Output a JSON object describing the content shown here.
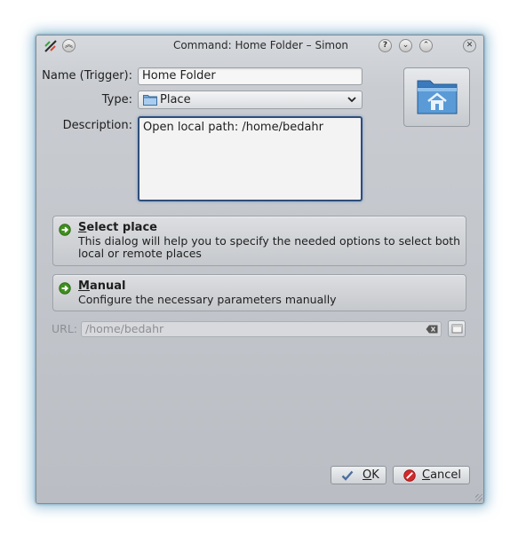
{
  "window": {
    "title": "Command: Home Folder – Simon",
    "titlebar_buttons": [
      "help",
      "minimize",
      "maximize",
      "close"
    ]
  },
  "form": {
    "name_label": "Name (Trigger):",
    "name_value": "Home Folder",
    "type_label": "Type:",
    "type_value": "Place",
    "type_icon": "folder-icon",
    "description_label": "Description:",
    "description_value": "Open local path: /home/bedahr",
    "command_icon": "home-folder-icon"
  },
  "options": [
    {
      "accel": "S",
      "title_rest": "elect place",
      "description": "This dialog will help you to specify the needed options to select both local or remote places"
    },
    {
      "accel": "M",
      "title_rest": "anual",
      "description": "Configure the necessary parameters manually"
    }
  ],
  "url": {
    "label": "URL:",
    "value": "/home/bedahr"
  },
  "buttons": {
    "ok_accel": "O",
    "ok_rest": "K",
    "cancel_accel": "C",
    "cancel_rest": "ancel"
  },
  "colors": {
    "accent_focus": "#2f4e7a",
    "go_arrow": "#3f8f1f",
    "cancel_red": "#d22a2a",
    "ok_check": "#4a6fa0"
  }
}
